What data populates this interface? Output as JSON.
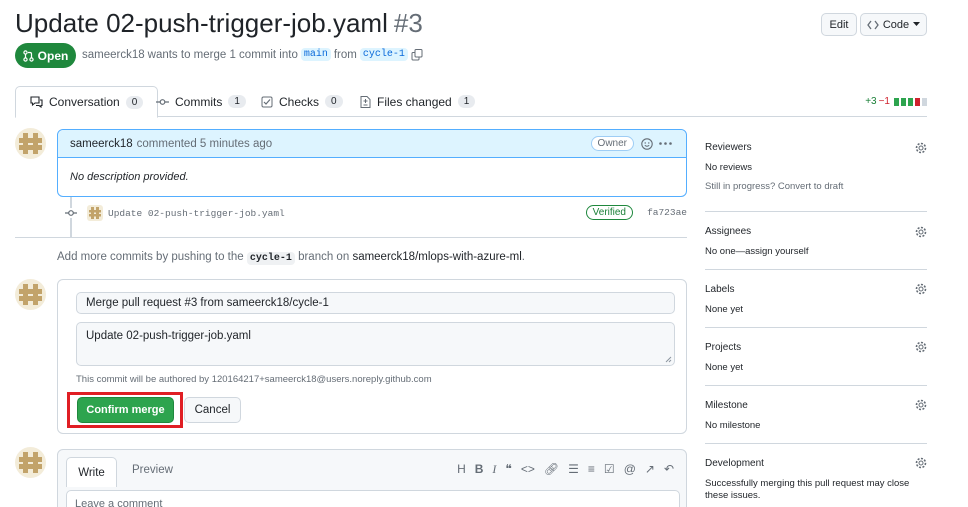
{
  "pr": {
    "title": "Update 02-push-trigger-job.yaml",
    "number": "#3",
    "state": "Open",
    "author": "sameerck18",
    "summary_mid": "wants to merge 1 commit into",
    "base_branch": "main",
    "summary_from": "from",
    "head_branch": "cycle-1"
  },
  "header_buttons": {
    "edit": "Edit",
    "code": "Code"
  },
  "tabs": [
    {
      "label": "Conversation",
      "count": "0"
    },
    {
      "label": "Commits",
      "count": "1"
    },
    {
      "label": "Checks",
      "count": "0"
    },
    {
      "label": "Files changed",
      "count": "1"
    }
  ],
  "diffstat": {
    "additions": "+3",
    "deletions": "−1"
  },
  "comment": {
    "author": "sameerck18",
    "action": "commented 5 minutes ago",
    "badge": "Owner",
    "body": "No description provided."
  },
  "commit": {
    "message": "Update 02-push-trigger-job.yaml",
    "verified": "Verified",
    "sha": "fa723ae"
  },
  "hint": {
    "prefix": "Add more commits by pushing to the",
    "branch": "cycle-1",
    "mid": "branch on",
    "repo": "sameerck18/mlops-with-azure-ml",
    "suffix": "."
  },
  "merge": {
    "title_value": "Merge pull request #3 from sameerck18/cycle-1",
    "body_value": "Update 02-push-trigger-job.yaml",
    "author_note": "This commit will be authored by 120164217+sameerck18@users.noreply.github.com",
    "confirm_label": "Confirm merge",
    "cancel_label": "Cancel"
  },
  "editor": {
    "write_tab": "Write",
    "preview_tab": "Preview",
    "placeholder": "Leave a comment",
    "toolbar": [
      "H",
      "B",
      "I",
      "quote-icon",
      "code-icon",
      "link-icon",
      "bulleted-list-icon",
      "numbered-list-icon",
      "task-list-icon",
      "mention-icon",
      "reference-icon",
      "undo-icon"
    ]
  },
  "sidebar": {
    "reviewers": {
      "heading": "Reviewers",
      "value": "No reviews",
      "extra_prefix": "Still in progress?",
      "extra_link": "Convert to draft"
    },
    "assignees": {
      "heading": "Assignees",
      "value": "No one—assign yourself"
    },
    "labels": {
      "heading": "Labels",
      "value": "None yet"
    },
    "projects": {
      "heading": "Projects",
      "value": "None yet"
    },
    "milestone": {
      "heading": "Milestone",
      "value": "No milestone"
    },
    "development": {
      "heading": "Development",
      "value": "Successfully merging this pull request may close these issues."
    }
  },
  "colors": {
    "open": "#1f883d",
    "merge_button": "#2da44e",
    "highlight": "#e01e24",
    "comment_header": "#ddf4ff"
  }
}
